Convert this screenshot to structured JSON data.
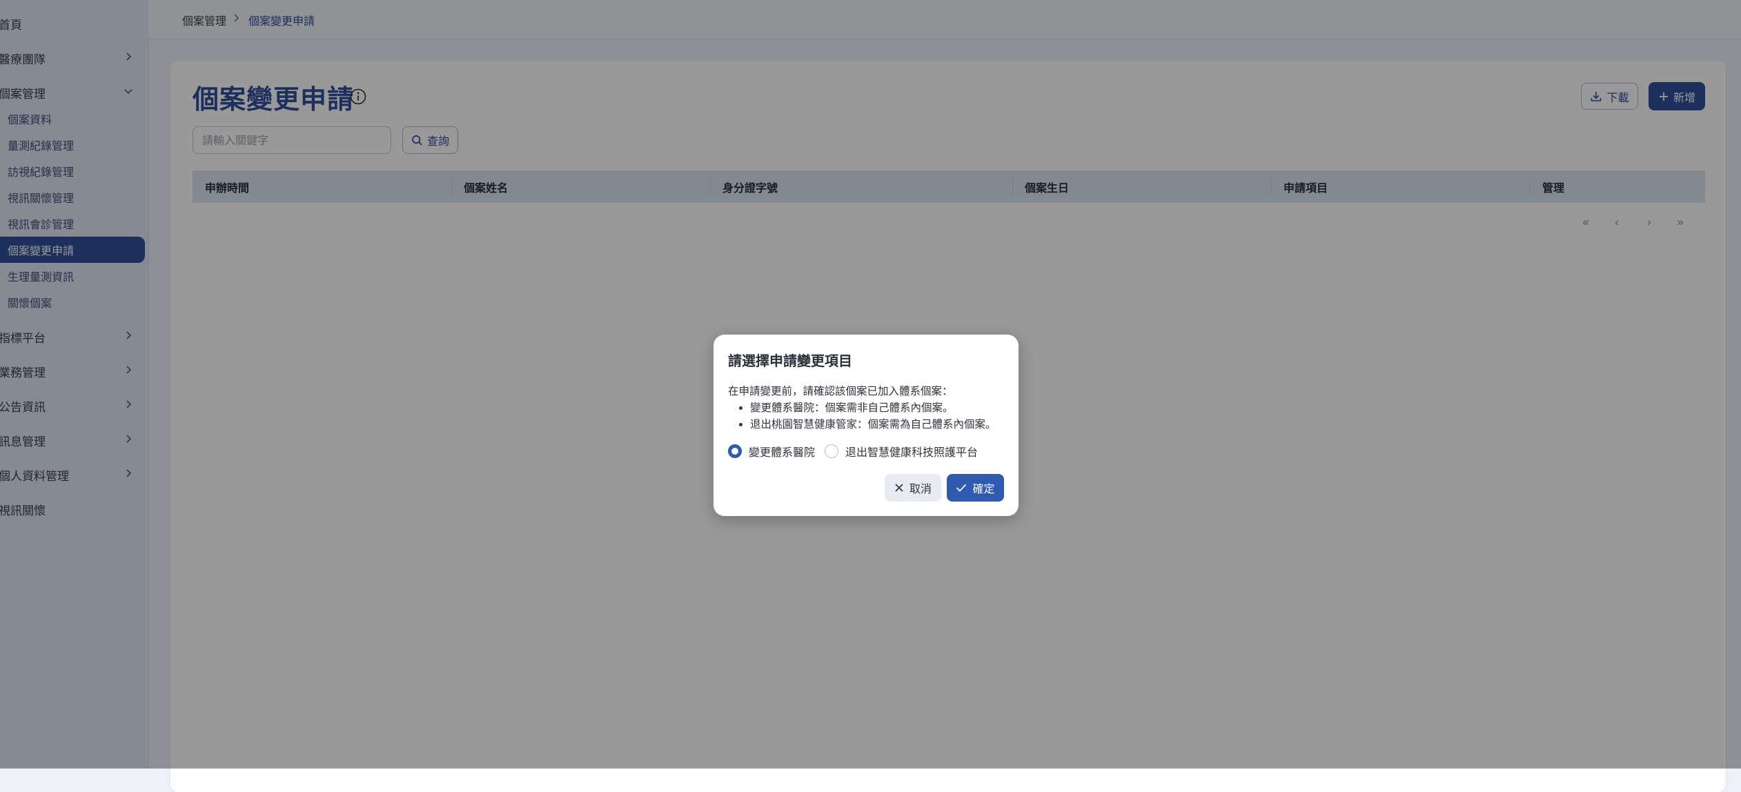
{
  "sidebar": {
    "items": [
      {
        "label": "首頁"
      },
      {
        "label": "醫療團隊"
      },
      {
        "label": "個案管理"
      },
      {
        "label": "指標平台"
      },
      {
        "label": "業務管理"
      },
      {
        "label": "公告資訊"
      },
      {
        "label": "訊息管理"
      },
      {
        "label": "個人資料管理"
      },
      {
        "label": "視訊關懷"
      }
    ],
    "sub_items": [
      {
        "label": "個案資料"
      },
      {
        "label": "量測紀錄管理"
      },
      {
        "label": "訪視紀錄管理"
      },
      {
        "label": "視訊關懷管理"
      },
      {
        "label": "視訊會診管理"
      },
      {
        "label": "個案變更申請",
        "active": true
      },
      {
        "label": "生理量測資訊"
      },
      {
        "label": "關懷個案"
      }
    ]
  },
  "breadcrumb": {
    "parent": "個案管理",
    "current": "個案變更申請"
  },
  "page": {
    "title": "個案變更申請",
    "download_label": "下載",
    "add_label": "新增",
    "search_placeholder": "請輸入關鍵字",
    "search_button": "查詢"
  },
  "table": {
    "columns": [
      "申辦時間",
      "個案姓名",
      "身分證字號",
      "個案生日",
      "申請項目",
      "管理"
    ],
    "rows": []
  },
  "pagination": {
    "first": "«",
    "prev": "‹",
    "next": "›",
    "last": "»"
  },
  "dialog": {
    "title": "請選擇申請變更項目",
    "intro": "在申請變更前，請確認該個案已加入體系個案：",
    "notes": [
      "變更體系醫院：個案需非自己體系內個案。",
      "退出桃園智慧健康管家：個案需為自己體系內個案。"
    ],
    "options": [
      {
        "label": "變更體系醫院",
        "checked": true
      },
      {
        "label": "退出智慧健康科技照護平台",
        "checked": false
      }
    ],
    "cancel_label": "取消",
    "confirm_label": "確定"
  },
  "colors": {
    "primary": "#2f4f9c",
    "accent": "#2f5aaf",
    "sidebar_bg": "#dfe6f3",
    "table_header_bg": "#dbe4f1"
  }
}
